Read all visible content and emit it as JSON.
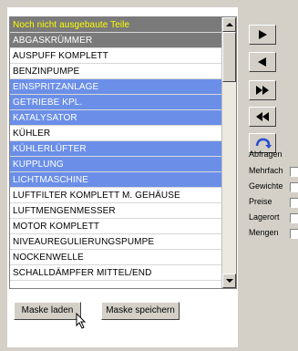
{
  "list": {
    "header": "Noch nicht ausgebaute Teile",
    "items": [
      {
        "label": "ABGASKRÜMMER",
        "state": "gray"
      },
      {
        "label": "AUSPUFF KOMPLETT",
        "state": "normal"
      },
      {
        "label": "BENZINPUMPE",
        "state": "normal"
      },
      {
        "label": "EINSPRITZANLAGE",
        "state": "selected"
      },
      {
        "label": "GETRIEBE KPL.",
        "state": "selected"
      },
      {
        "label": "KATALYSATOR",
        "state": "selected"
      },
      {
        "label": "KÜHLER",
        "state": "normal"
      },
      {
        "label": "KÜHLERLÜFTER",
        "state": "selected"
      },
      {
        "label": "KUPPLUNG",
        "state": "selected"
      },
      {
        "label": "LICHTMASCHINE",
        "state": "selected"
      },
      {
        "label": "LUFTFILTER KOMPLETT M. GEHÄUSE",
        "state": "normal"
      },
      {
        "label": "LUFTMENGENMESSER",
        "state": "normal"
      },
      {
        "label": "MOTOR KOMPLETT",
        "state": "normal"
      },
      {
        "label": "NIVEAUREGULIERUNGSPUMPE",
        "state": "normal"
      },
      {
        "label": "NOCKENWELLE",
        "state": "normal"
      },
      {
        "label": "SCHALLDÄMPFER MITTEL/END",
        "state": "normal"
      }
    ]
  },
  "buttons": {
    "load_mask": "Maske laden",
    "save_mask": "Maske speichern"
  },
  "nav_icons": [
    "play-right-icon",
    "play-left-icon",
    "fast-forward-icon",
    "rewind-icon",
    "refresh-icon"
  ],
  "options": {
    "title": "Abfragen",
    "items": [
      "Mehrfach",
      "Gewichte",
      "Preise",
      "Lagerort",
      "Mengen"
    ]
  },
  "colors": {
    "selected": "#6b8fe8",
    "header_bg": "#7a7a7a",
    "header_text": "#ffff00"
  }
}
